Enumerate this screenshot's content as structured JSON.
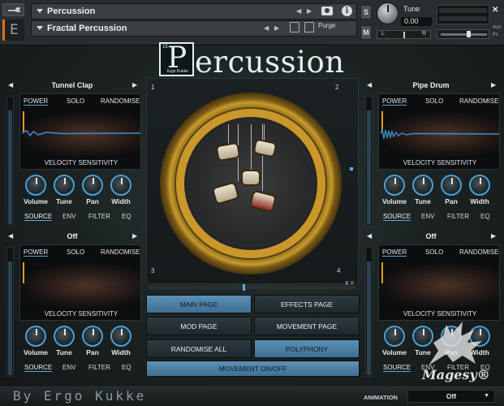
{
  "header": {
    "instrument_name": "Percussion",
    "multi_name": "Fractal Percussion",
    "purge_label": "Purge",
    "s_label": "S",
    "m_label": "M",
    "tune_label": "Tune",
    "tune_value": "0.00",
    "left_label": "L",
    "right_label": "R",
    "close_label": "✕",
    "aux_label": "AUX",
    "pv_label": "PV"
  },
  "logo": {
    "letter": "P",
    "rest": "ercussion",
    "box_number": "15",
    "box_sub": "Ergo Kukke"
  },
  "panel_tabs": {
    "power": "POWER",
    "solo": "SOLO",
    "randomise": "RANDOMISE",
    "velocity": "VELOCITY SENSITIVITY",
    "knob_volume": "Volume",
    "knob_tune": "Tune",
    "knob_pan": "Pan",
    "knob_width": "Width",
    "source": "SOURCE",
    "env": "ENV",
    "filter": "FILTER",
    "eq": "EQ"
  },
  "panels": {
    "p1": {
      "name": "Tunnel Clap"
    },
    "p2": {
      "name": "Pipe Drum"
    },
    "p3": {
      "name": "Off"
    },
    "p4": {
      "name": "Off"
    }
  },
  "drum_zone": {
    "corner1": "1",
    "corner2": "2",
    "corner3": "3",
    "corner4": "4",
    "xy_label": "X Y"
  },
  "menu": {
    "main_page": "MAIN PAGE",
    "effects_page": "EFFECTS PAGE",
    "mod_page": "MOD PAGE",
    "movement_page": "MOVEMENT PAGE",
    "randomise_all": "RANDOMISE ALL",
    "polyphony": "POLYPHONY",
    "movement_onoff": "MOVEMENT ON/OFF"
  },
  "footer": {
    "by": "By Ergo Kukke",
    "animation_label": "ANIMATION",
    "animation_value": "Off"
  },
  "watermark": "Magesy®",
  "colors": {
    "accent_blue": "#48a0d8",
    "highlight_button": "#5d90b4",
    "kontakt_orange": "#e0701c",
    "gold": "#c9972a"
  }
}
